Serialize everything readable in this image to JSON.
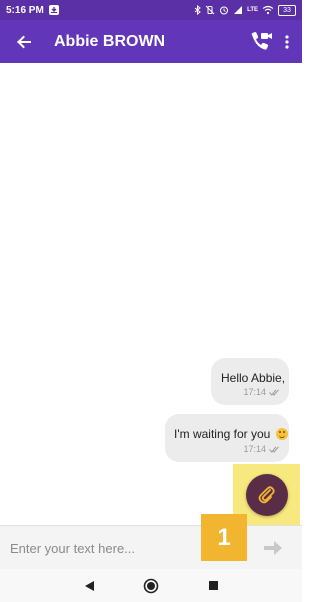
{
  "status_bar": {
    "time": "5:16 PM",
    "notification_icon": "notification-icon",
    "icons": [
      "bluetooth-icon",
      "vibrate-off-icon",
      "alarm-icon",
      "signal-icon",
      "lte-icon",
      "wifi-icon"
    ],
    "lte_label": "LTE",
    "battery_level": "33"
  },
  "app_bar": {
    "contact_name": "Abbie BROWN",
    "background": "#6236b8"
  },
  "messages": [
    {
      "text": "Hello Abbie,",
      "time": "17:14"
    },
    {
      "text": "I'm waiting for you",
      "time": "17:14"
    }
  ],
  "fab": {
    "icon": "paperclip-icon",
    "color": "#5a2d47"
  },
  "callout": {
    "label": "1",
    "color": "#f2b52f",
    "highlight": "#f7e97d"
  },
  "composer": {
    "placeholder": "Enter your text here...",
    "value": ""
  },
  "nav": {
    "icons": [
      "back-icon",
      "home-icon",
      "recents-icon"
    ]
  }
}
